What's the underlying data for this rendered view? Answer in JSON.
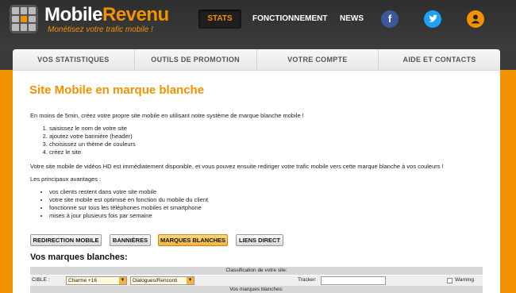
{
  "header": {
    "logo_text_part1": "Mobile",
    "logo_text_part2": "Revenu",
    "tagline": "Monétisez votre trafic mobile !",
    "nav": [
      "STATS",
      "FONCTIONNEMENT",
      "NEWS"
    ],
    "active_nav": "STATS",
    "social_icons": [
      "facebook-icon",
      "twitter-icon",
      "user-icon"
    ]
  },
  "tabs": [
    "VOS STATISTIQUES",
    "OUTILS DE PROMOTION",
    "VOTRE COMPTE",
    "AIDE ET CONTACTS"
  ],
  "page": {
    "title": "Site Mobile en marque blanche",
    "intro": "En moins de 5min, créez votre propre site mobile en utilisant notre système de marque blanche mobile !",
    "steps": [
      "saisissez le nom de votre site",
      "ajoutez votre bannière (header)",
      "choisissez un thème de couleurs",
      "créez le site"
    ],
    "para2": "Votre site mobile de vidéos HD est immédiatement disponible, et vous pouvez ensuite rediriger votre trafic mobile vers cette marque blanche à vos couleurs !",
    "para3": "Les principaux avantages :",
    "advantages": [
      "vos clients restent dans votre site mobile",
      "votre site mobile est optimisé en fonction du mobile du client",
      "fonctionne sur tous les téléphones mobiles et smartphone",
      "mises à jour plusieurs fois par semaine"
    ]
  },
  "buttons": [
    "REDIRECTION MOBILE",
    "BANNIÈRES",
    "MARQUES BLANCHES",
    "LIENS DIRECT"
  ],
  "active_button": "MARQUES BLANCHES",
  "form": {
    "section_title": "Vos marques blanches:",
    "classification_header": "Classification de votre site:",
    "cible_label": "CIBLE :",
    "cible_value": "Charme +16",
    "category_value": "Dialogues/Renconti",
    "tracker_label": "Tracker:",
    "tracker_value": "",
    "warning_label": "Warning",
    "warning_checked": false,
    "list_header": "Vos marques blanches:"
  },
  "colors": {
    "accent": "#f39200",
    "header_bg": "#333333",
    "facebook": "#3b5998",
    "twitter": "#1da1f2"
  }
}
